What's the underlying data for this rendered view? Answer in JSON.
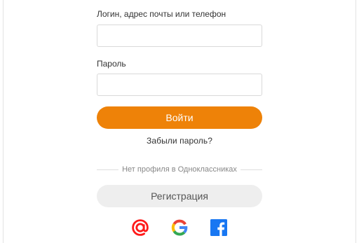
{
  "login_form": {
    "login_label": "Логин, адрес почты или телефон",
    "login_value": "",
    "password_label": "Пароль",
    "password_value": "",
    "submit_label": "Войти",
    "forgot_link": "Забыли пароль?"
  },
  "register": {
    "divider_text": "Нет профиля в Одноклассниках",
    "button_label": "Регистрация"
  },
  "social_login": {
    "icons": [
      "mail-ru-icon",
      "google-icon",
      "facebook-icon"
    ]
  },
  "colors": {
    "accent": "#ee8208",
    "mail_ru": "#ff1a1a",
    "facebook": "#1877f2",
    "register_bg": "#eeeeee"
  }
}
